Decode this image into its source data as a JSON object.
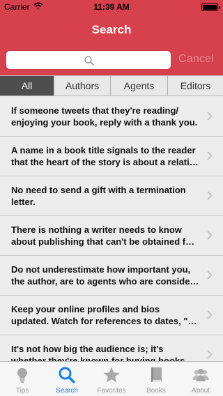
{
  "status": {
    "carrier": "Carrier",
    "time": "11:39 AM"
  },
  "nav": {
    "title": "Search"
  },
  "search": {
    "placeholder": "",
    "value": "",
    "cancel_label": "Cancel"
  },
  "segments": [
    {
      "label": "All",
      "active": true
    },
    {
      "label": "Authors",
      "active": false
    },
    {
      "label": "Agents",
      "active": false
    },
    {
      "label": "Editors",
      "active": false
    }
  ],
  "tips": [
    {
      "line1": "If someone tweets that they're reading/",
      "line2": "enjoying your book, reply with a thank you."
    },
    {
      "line1": "A name in a book title signals to the reader",
      "line2": "that the heart of the story is about a relati…"
    },
    {
      "line1": "No need to send a gift with a termination",
      "line2": "letter."
    },
    {
      "line1": "There is nothing a writer needs to know",
      "line2": "about publishing that can't be obtained f…"
    },
    {
      "line1": "Do not underestimate how important you,",
      "line2": "the author, are to agents who are conside…"
    },
    {
      "line1": "Keep your online profiles and bios",
      "line2": "updated. Watch for references to dates, \"…"
    },
    {
      "line1": "It's not how big the audience is; it's",
      "line2": "whether they're known for buying books."
    }
  ],
  "tabs": [
    {
      "label": "Tips",
      "icon": "lightbulb-icon",
      "active": false
    },
    {
      "label": "Search",
      "icon": "search-icon",
      "active": true
    },
    {
      "label": "Favorites",
      "icon": "star-icon",
      "active": false
    },
    {
      "label": "Books",
      "icon": "book-icon",
      "active": false
    },
    {
      "label": "About",
      "icon": "people-icon",
      "active": false
    }
  ],
  "colors": {
    "nav_red": "#d7404d",
    "active_tab": "#1a7fe0",
    "inactive_tab": "#9b9b9b",
    "segment_active": "#4e4e4e"
  }
}
